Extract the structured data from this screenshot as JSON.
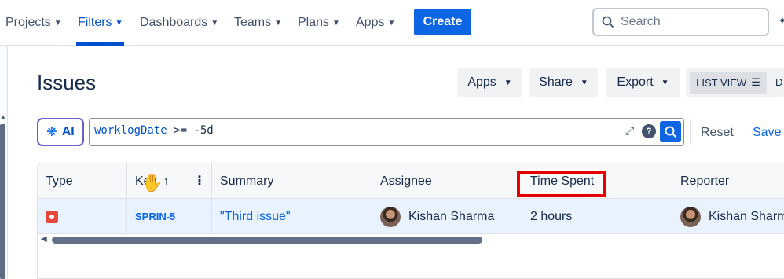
{
  "nav": {
    "items": [
      {
        "label": "Projects"
      },
      {
        "label": "Filters"
      },
      {
        "label": "Dashboards"
      },
      {
        "label": "Teams"
      },
      {
        "label": "Plans"
      },
      {
        "label": "Apps"
      }
    ],
    "create_label": "Create",
    "search_placeholder": "Search"
  },
  "page": {
    "title": "Issues",
    "buttons": {
      "apps": "Apps",
      "share": "Share",
      "export": "Export"
    },
    "view": {
      "list_view": "LIST VIEW",
      "next_partial": "D"
    }
  },
  "jql": {
    "ai_label": "AI",
    "field": "worklogDate",
    "operator": ">=",
    "value": "-5d",
    "reset_label": "Reset",
    "save_label": "Save f"
  },
  "table": {
    "columns": [
      "Type",
      "Key",
      "Summary",
      "Assignee",
      "Time Spent",
      "Reporter"
    ],
    "rows": [
      {
        "type": "bug",
        "key": "SPRIN-5",
        "summary": "\"Third issue\"",
        "assignee": "Kishan Sharma",
        "time_spent": "2 hours",
        "reporter": "Kishan Sharma"
      }
    ]
  },
  "colors": {
    "primary": "#0c66e4",
    "highlight": "#e60000",
    "selected_row": "#e9f2ff",
    "bug": "#e5493a"
  }
}
